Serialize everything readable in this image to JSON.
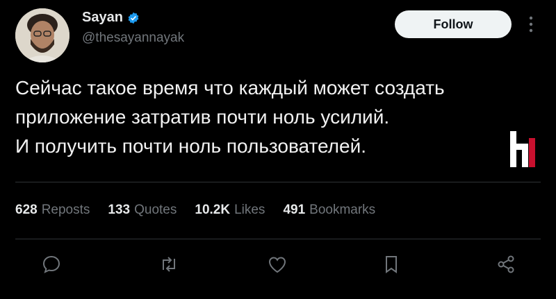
{
  "author": {
    "name": "Sayan",
    "handle": "@thesayannayak",
    "verified": true,
    "avatar_icon": "avatar-photo"
  },
  "follow_label": "Follow",
  "tweet_text": "Сейчас такое время что каждый может создать\nприложение затратив почти ноль усилий.\nИ получить почти ноль пользователей.",
  "stats": [
    {
      "num": "628",
      "label": "Reposts"
    },
    {
      "num": "133",
      "label": "Quotes"
    },
    {
      "num": "10.2K",
      "label": "Likes"
    },
    {
      "num": "491",
      "label": "Bookmarks"
    }
  ],
  "actions": [
    "reply-icon",
    "repost-icon",
    "like-icon",
    "bookmark-icon",
    "share-icon"
  ],
  "colors": {
    "background": "#000000",
    "text": "#e7e9ea",
    "muted": "#71767b",
    "verified": "#1d9bf0",
    "divider": "#2f3336",
    "logo_red": "#c8102e"
  }
}
